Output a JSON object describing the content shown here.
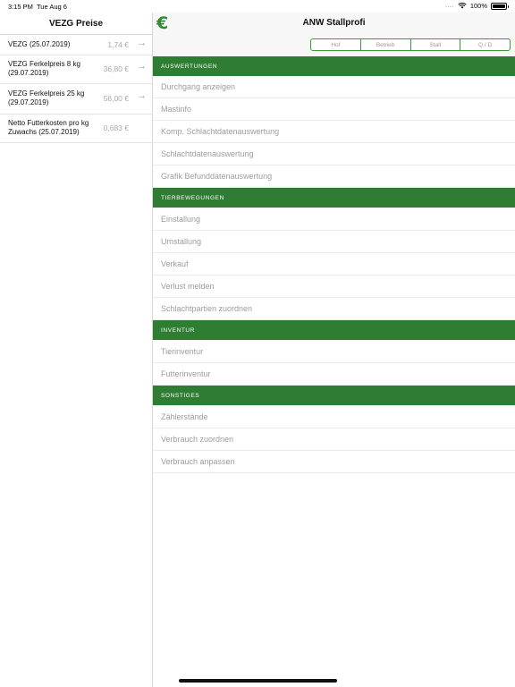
{
  "status_bar": {
    "time": "3:15 PM",
    "date": "Tue Aug 6",
    "signal_dots": "....",
    "battery": "100%"
  },
  "left": {
    "title": "VEZG Preise",
    "prices": [
      {
        "label": "VEZG (25.07.2019)",
        "value": "1,74 €",
        "arrow": "→"
      },
      {
        "label": "VEZG Ferkelpreis 8 kg (29.07.2019)",
        "value": "36,80 €",
        "arrow": "→"
      },
      {
        "label": "VEZG Ferkelpreis 25 kg (29.07.2019)",
        "value": "56,00 €",
        "arrow": "→"
      },
      {
        "label": "Netto Futterkosten pro kg Zuwachs (25.07.2019)",
        "value": "0,683 €",
        "arrow": ""
      }
    ]
  },
  "right": {
    "logo_symbol": "€",
    "title": "ANW Stallprofi",
    "segments": [
      "Hof",
      "Betrieb",
      "Stall",
      "Q / D"
    ],
    "sections": [
      {
        "title": "AUSWERTUNGEN",
        "items": [
          "Durchgang anzeigen",
          "Mastinfo",
          "Komp. Schlachtdatenauswertung",
          "Schlachtdatenauswertung",
          "Grafik Befunddatenauswertung"
        ]
      },
      {
        "title": "TIERBEWEGUNGEN",
        "items": [
          "Einstallung",
          "Umstallung",
          "Verkauf",
          "Verlust melden",
          "Schlachtpartien zuordnen"
        ]
      },
      {
        "title": "INVENTUR",
        "items": [
          "Tierinventur",
          "Futterinventur"
        ]
      },
      {
        "title": "SONSTIGES",
        "items": [
          "Zählerstände",
          "Verbrauch zuordnen",
          "Verbrauch anpassen"
        ]
      }
    ]
  },
  "colors": {
    "accent_green": "#2e7d32",
    "segment_border": "#3a9a3a",
    "menu_text": "#9d9d9d"
  }
}
